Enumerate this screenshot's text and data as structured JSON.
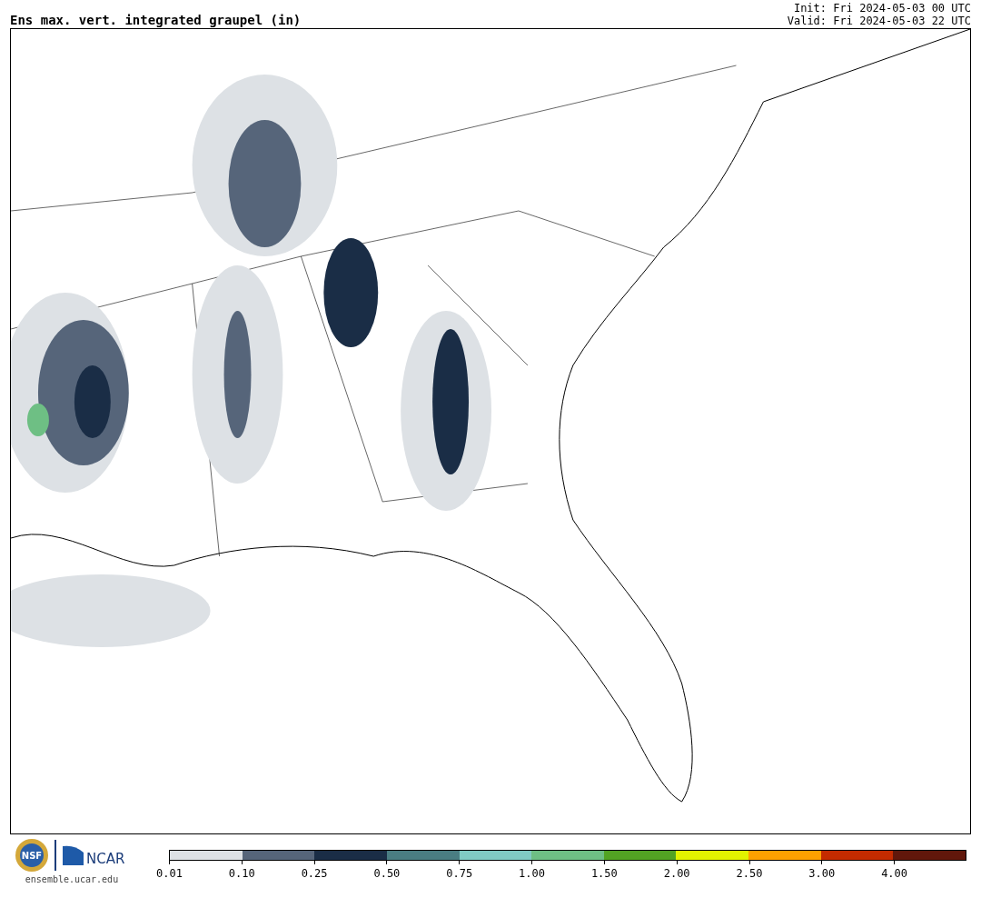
{
  "title": "Ens max. vert. integrated graupel (in)",
  "init": "Init: Fri 2024-05-03 00 UTC",
  "valid": "Valid: Fri 2024-05-03 22 UTC",
  "logos": {
    "nsf": "NSF",
    "ncar": "NCAR",
    "site": "ensemble.ucar.edu"
  },
  "colorbar": [
    {
      "label": "0.01",
      "color": "#dde1e5"
    },
    {
      "label": "0.10",
      "color": "#56657a"
    },
    {
      "label": "0.25",
      "color": "#1a2d46"
    },
    {
      "label": "0.50",
      "color": "#4a7d82"
    },
    {
      "label": "0.75",
      "color": "#80cbc4"
    },
    {
      "label": "1.00",
      "color": "#6ebf84"
    },
    {
      "label": "1.50",
      "color": "#52a323"
    },
    {
      "label": "2.00",
      "color": "#e2f300"
    },
    {
      "label": "2.50",
      "color": "#fea000"
    },
    {
      "label": "3.00",
      "color": "#c42b00"
    },
    {
      "label": "4.00",
      "color": "#61170b"
    }
  ]
}
